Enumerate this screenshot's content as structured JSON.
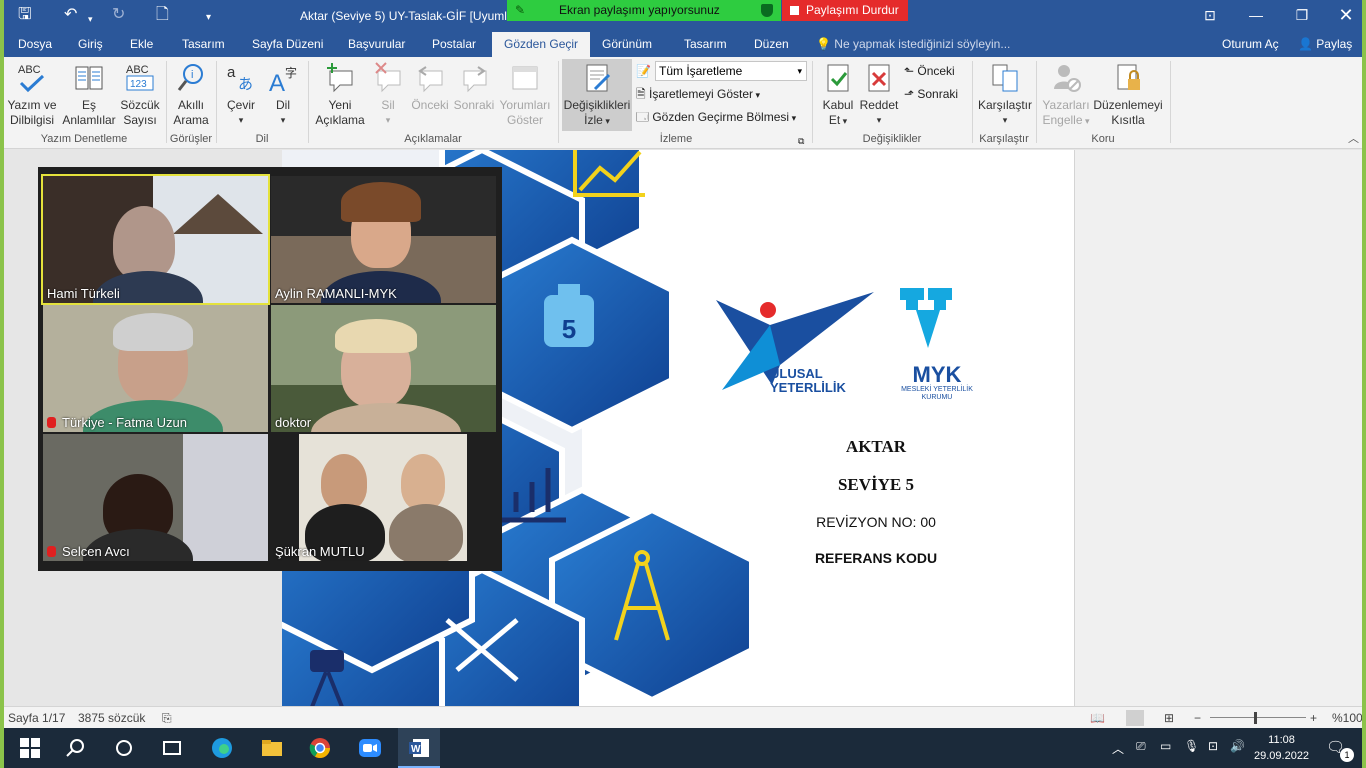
{
  "window": {
    "title": "Aktar (Seviye 5) UY-Taslak-GİF [Uyumlu"
  },
  "share": {
    "banner": "Ekran paylaşımı yapıyorsunuz",
    "stop": "Paylaşımı Durdur"
  },
  "tabs": [
    "Dosya",
    "Giriş",
    "Ekle",
    "Tasarım",
    "Sayfa Düzeni",
    "Başvurular",
    "Postalar",
    "Gözden Geçir",
    "Görünüm",
    "Tasarım",
    "Düzen"
  ],
  "tellme": "Ne yapmak istediğinizi söyleyin...",
  "account": {
    "signin": "Oturum Aç",
    "share": "Paylaş"
  },
  "ribbon": {
    "proofing": {
      "spelling": "Yazım ve",
      "spelling2": "Dilbilgisi",
      "thesaurus": "Eş",
      "thesaurus2": "Anlamlılar",
      "wordcount": "Sözcük",
      "wordcount2": "Sayısı",
      "group": "Yazım Denetleme"
    },
    "insights": {
      "smart": "Akıllı",
      "smart2": "Arama",
      "group": "Görüşler"
    },
    "language": {
      "translate": "Çevir",
      "lang": "Dil",
      "group": "Dil"
    },
    "comments": {
      "new": "Yeni",
      "new2": "Açıklama",
      "delete": "Sil",
      "prev": "Önceki",
      "next": "Sonraki",
      "show": "Yorumları",
      "show2": "Göster",
      "group": "Açıklamalar"
    },
    "tracking": {
      "track": "Değişiklikleri",
      "track2": "İzle",
      "markup": "Tüm İşaretleme",
      "showmarkup": "İşaretlemeyi Göster",
      "pane": "Gözden Geçirme Bölmesi",
      "group": "İzleme"
    },
    "changes": {
      "accept": "Kabul",
      "accept2": "Et",
      "reject": "Reddet",
      "prev": "Önceki",
      "next": "Sonraki",
      "group": "Değişiklikler"
    },
    "compare": {
      "compare": "Karşılaştır",
      "group": "Karşılaştır"
    },
    "protect": {
      "block": "Yazarları",
      "block2": "Engelle",
      "restrict": "Düzenlemeyi",
      "restrict2": "Kısıtla",
      "group": "Koru"
    }
  },
  "document": {
    "logo1a": "ULUSAL",
    "logo1b": "YETERLİLİK",
    "logo2a": "MYK",
    "logo2b": "MESLEKİ YETERLİLİK",
    "logo2c": "KURUMU",
    "hex_number": "5",
    "title": "AKTAR",
    "level": "SEVİYE 5",
    "revision": "REVİZYON NO: 00",
    "ref": "REFERANS KODU"
  },
  "participants": [
    {
      "name": "Hami Türkeli",
      "muted": false,
      "active": true
    },
    {
      "name": "Aylin RAMANLI-MYK",
      "muted": false,
      "active": false
    },
    {
      "name": "Türkiye - Fatma Uzun",
      "muted": true,
      "active": false
    },
    {
      "name": "doktor",
      "muted": false,
      "active": false
    },
    {
      "name": "Selcen Avcı",
      "muted": true,
      "active": false
    },
    {
      "name": "Şükran MUTLU",
      "muted": false,
      "active": false
    }
  ],
  "status": {
    "page": "Sayfa 1/17",
    "words": "3875 sözcük",
    "zoom": "%100"
  },
  "clock": {
    "time": "11:08",
    "date": "29.09.2022"
  },
  "notifications": "1",
  "colors": {
    "ribbon_blue": "#2b579a",
    "hex_blue": "#1f5fa8",
    "accent_green": "#2ecc40",
    "stop_red": "#e52b2b"
  }
}
